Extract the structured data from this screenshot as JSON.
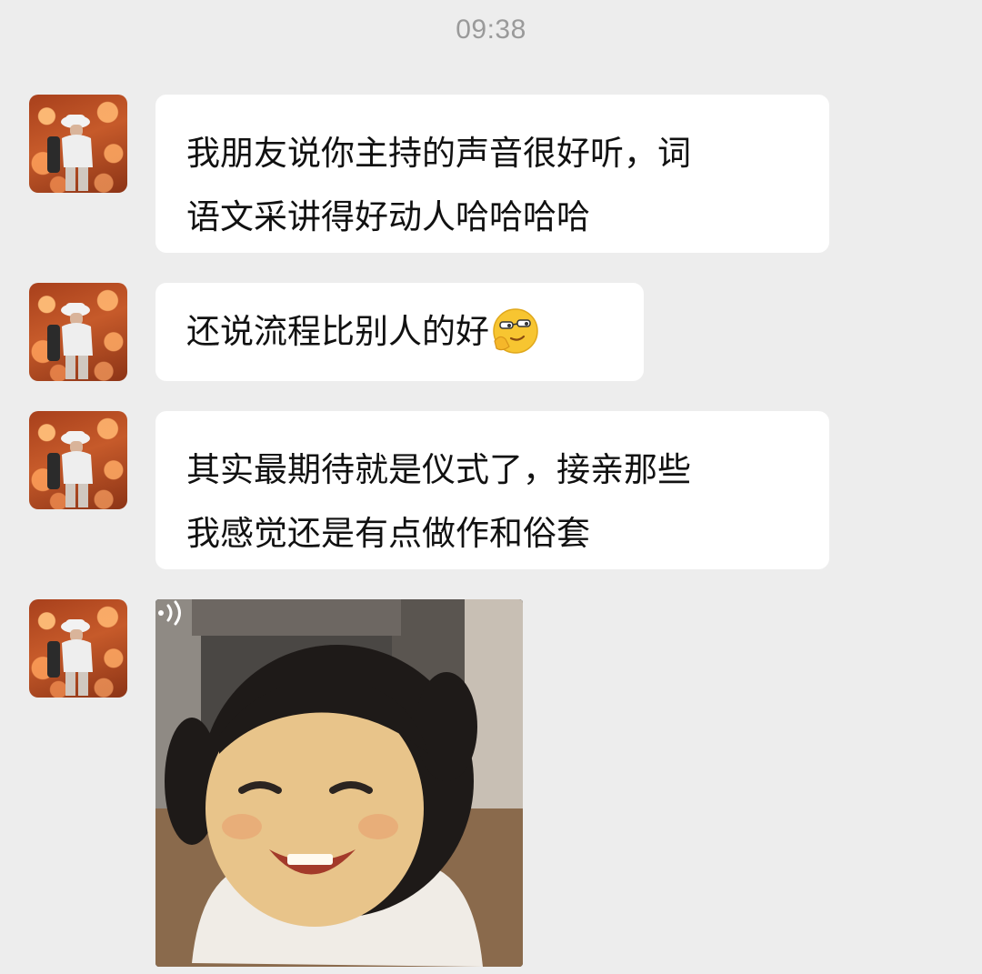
{
  "chat": {
    "timestamp": "09:38",
    "messages": [
      {
        "type": "text",
        "lines": [
          "我朋友说你主持的声音很好听，词",
          "语文采讲得好动人哈哈哈哈"
        ]
      },
      {
        "type": "text",
        "lines": [
          "还说流程比别人的好"
        ],
        "trailing_emoji": "smirk-glasses-emoji"
      },
      {
        "type": "text",
        "lines": [
          "其实最期待就是仪式了，接亲那些",
          "我感觉还是有点做作和俗套"
        ]
      },
      {
        "type": "image",
        "content": "child-smiling-photo",
        "overlay_icon": "sound-icon"
      }
    ]
  },
  "colors": {
    "background": "#ededed",
    "bubble": "#ffffff",
    "text": "#111111",
    "timestamp": "#9a9a9a"
  }
}
